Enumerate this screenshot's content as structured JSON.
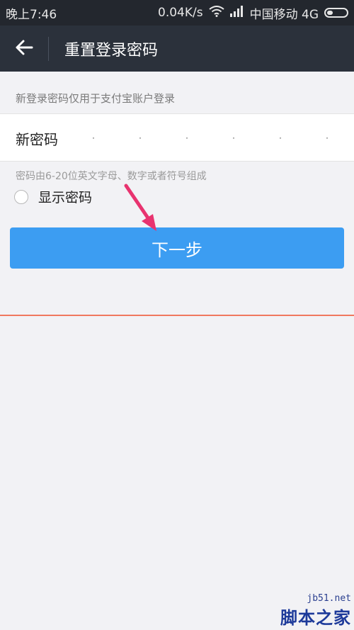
{
  "status_bar": {
    "time": "晚上7:46",
    "speed": "0.04K/s",
    "carrier": "中国移动 4G",
    "icons": [
      "wifi-icon",
      "signal-icon",
      "battery-icon"
    ]
  },
  "header": {
    "title": "重置登录密码",
    "back_icon": "back-arrow-icon"
  },
  "form": {
    "hint": "新登录密码仅用于支付宝账户登录",
    "password_label": "新密码",
    "password_value": "······",
    "rule": "密码由6-20位英文字母、数字或者符号组成",
    "show_password_label": "显示密码",
    "show_password_checked": false,
    "next_button": "下一步"
  },
  "colors": {
    "header_bg": "#2b313b",
    "button_bg": "#3c9df2",
    "annotation_arrow": "#e8336f",
    "divider_line": "#f0785e"
  },
  "watermark": {
    "url": "jb51.net",
    "name": "脚本之家"
  }
}
